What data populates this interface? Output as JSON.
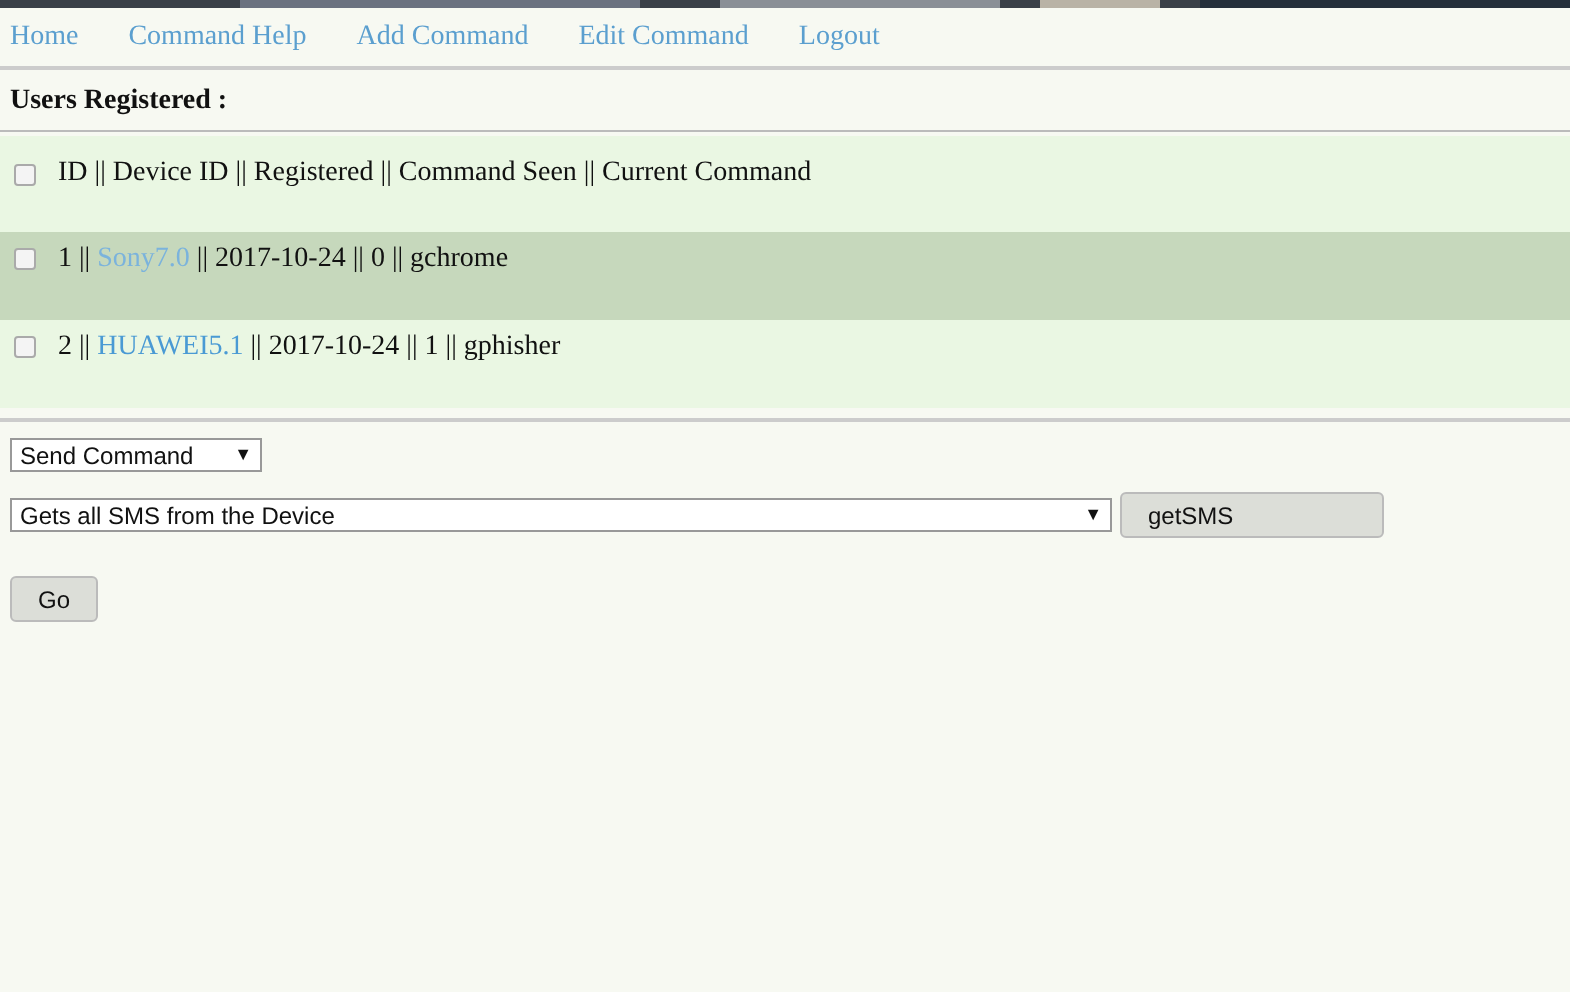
{
  "nav": [
    "Home",
    "Command Help",
    "Add Command",
    "Edit Command",
    "Logout"
  ],
  "heading": "Users Registered :",
  "header_row": {
    "checked": false,
    "text": "ID || Device ID || Registered || Command Seen || Current Command"
  },
  "rows": [
    {
      "checked": false,
      "selected": true,
      "before": "1 ||",
      "device": "Sony7.0",
      "after": "|| 2017-10-24 || 0 || gchrome"
    },
    {
      "checked": false,
      "selected": false,
      "before": "2 ||",
      "device": "HUAWEI5.1",
      "after": "|| 2017-10-24 || 1 || gphisher"
    }
  ],
  "mode_select": {
    "value": "Send Command",
    "arrow": "▼"
  },
  "command_select": {
    "value": "Gets all SMS from the Device",
    "arrow": "▼"
  },
  "command_button": "getSMS",
  "go_button": "Go"
}
